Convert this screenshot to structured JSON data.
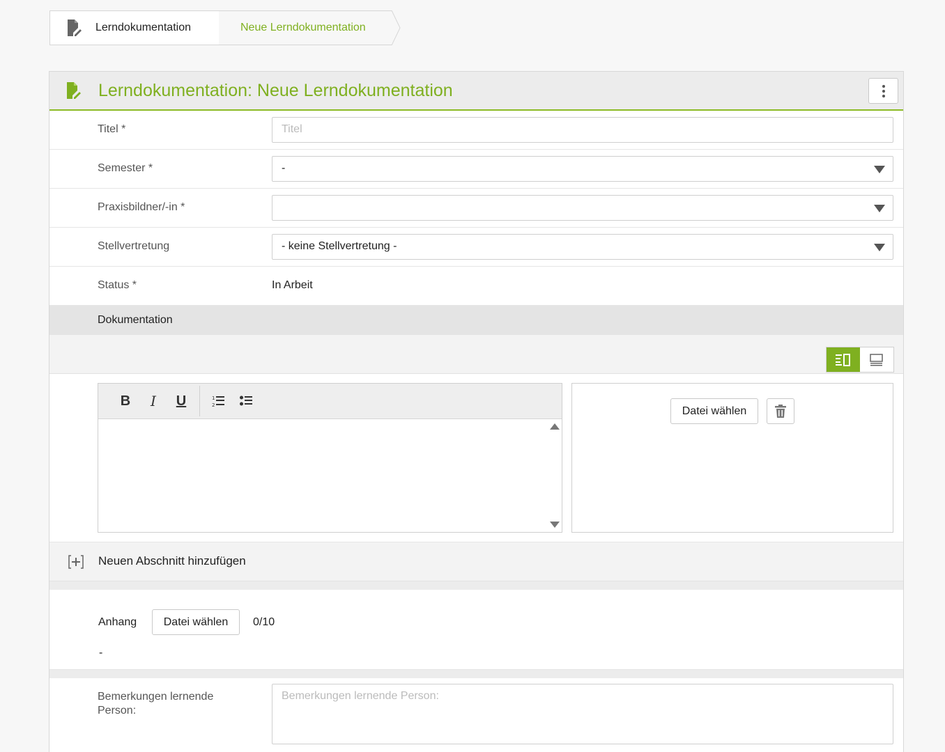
{
  "breadcrumb": {
    "items": [
      {
        "label": "Lerndokumentation",
        "icon": "document-edit-icon"
      },
      {
        "label": "Neue Lerndokumentation"
      }
    ]
  },
  "panel": {
    "title": "Lerndokumentation: Neue Lerndokumentation",
    "icon": "document-edit-icon",
    "menu_icon": "kebab-menu-icon"
  },
  "form": {
    "titel": {
      "label": "Titel *",
      "placeholder": "Titel",
      "value": ""
    },
    "semester": {
      "label": "Semester *",
      "value": "-"
    },
    "praxisbildner": {
      "label": "Praxisbildner/-in *",
      "value": ""
    },
    "stellvertretung": {
      "label": "Stellvertretung",
      "value": "- keine Stellvertretung -"
    },
    "status": {
      "label": "Status *",
      "value": "In Arbeit"
    }
  },
  "dokumentation": {
    "heading": "Dokumentation",
    "toolbar": {
      "bold": "B",
      "italic": "I",
      "underline": "U"
    },
    "file_button": "Datei wählen",
    "add_section": "Neuen Abschnitt hinzufügen"
  },
  "anhang": {
    "label": "Anhang",
    "button": "Datei wählen",
    "count": "0/10",
    "list": "-"
  },
  "remarks": {
    "label": "Bemerkungen lernende Person:",
    "placeholder": "Bemerkungen lernende Person:"
  },
  "colors": {
    "accent": "#7fb020",
    "border": "#cfcfcf"
  }
}
